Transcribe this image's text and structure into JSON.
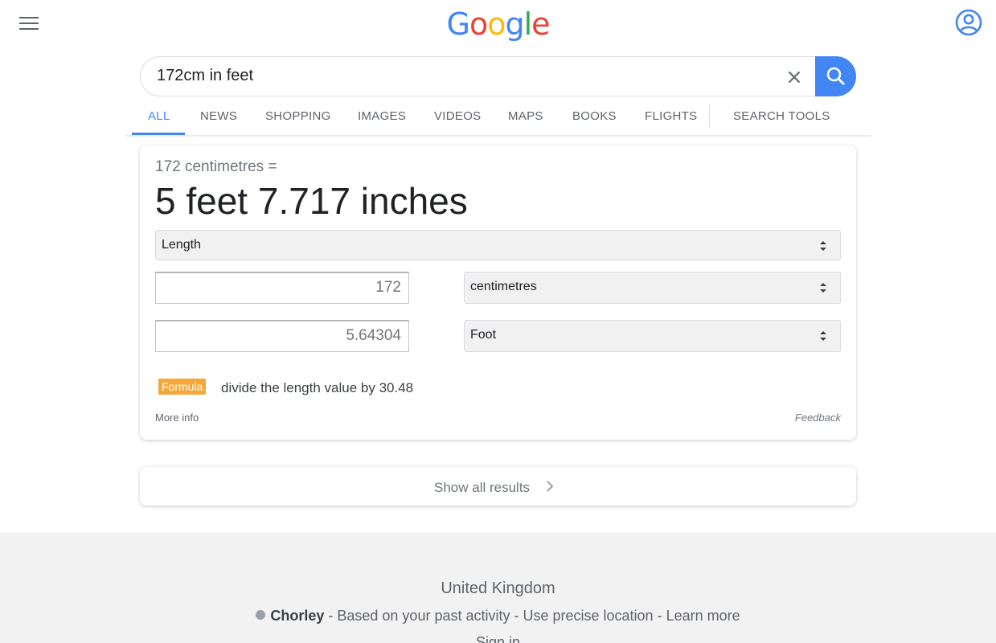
{
  "header": {
    "logo_letters": [
      {
        "ch": "G",
        "color": "#4285f4"
      },
      {
        "ch": "o",
        "color": "#ea4335"
      },
      {
        "ch": "o",
        "color": "#fbbc05"
      },
      {
        "ch": "g",
        "color": "#4285f4"
      },
      {
        "ch": "l",
        "color": "#34a853"
      },
      {
        "ch": "e",
        "color": "#ea4335"
      }
    ],
    "menu_icon": "hamburger-icon",
    "account_icon": "account-circle-icon",
    "accent_color": "#4285f4"
  },
  "search": {
    "query": "172cm in feet",
    "clear_icon": "close-icon",
    "search_icon": "search-icon"
  },
  "tabs": [
    {
      "label": "ALL",
      "active": true
    },
    {
      "label": "NEWS"
    },
    {
      "label": "SHOPPING"
    },
    {
      "label": "IMAGES"
    },
    {
      "label": "VIDEOS"
    },
    {
      "label": "MAPS"
    },
    {
      "label": "BOOKS"
    },
    {
      "label": "FLIGHTS"
    },
    {
      "label": "SEARCH TOOLS"
    }
  ],
  "converter": {
    "from_text": "172 centimetres =",
    "result_text": "5 feet 7.717 inches",
    "category": "Length",
    "input_value": "172",
    "input_unit": "centimetres",
    "output_value": "5.64304",
    "output_unit": "Foot",
    "formula_label": "Formula",
    "formula_text": "divide the length value by 30.48",
    "more_info": "More info",
    "feedback": "Feedback",
    "formula_color": "#f4a83c"
  },
  "show_all": {
    "label": "Show all results"
  },
  "footer": {
    "country": "United Kingdom",
    "city": "Chorley",
    "past_activity": " - Based on your past activity - ",
    "precise_location": "Use precise location",
    "separator": " - ",
    "learn_more": "Learn more",
    "sign_in": "Sign in"
  }
}
